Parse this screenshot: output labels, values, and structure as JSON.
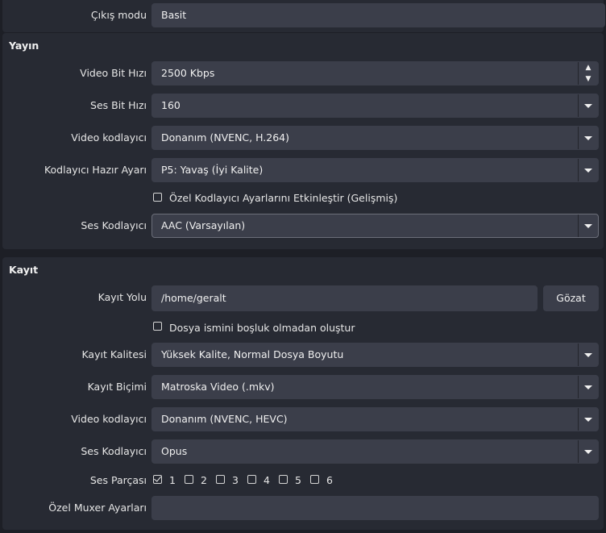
{
  "output_mode": {
    "label": "Çıkış modu",
    "value": "Basit"
  },
  "stream": {
    "title": "Yayın",
    "video_bitrate": {
      "label": "Video Bit Hızı",
      "value": "2500 Kbps"
    },
    "audio_bitrate": {
      "label": "Ses Bit Hızı",
      "value": "160"
    },
    "video_encoder": {
      "label": "Video kodlayıcı",
      "value": "Donanım (NVENC, H.264)"
    },
    "encoder_preset": {
      "label": "Kodlayıcı Hazır Ayarı",
      "value": "P5: Yavaş (İyi Kalite)"
    },
    "custom_encoder_checkbox": {
      "label": "Özel Kodlayıcı Ayarlarını Etkinleştir (Gelişmiş)",
      "checked": false
    },
    "audio_encoder": {
      "label": "Ses Kodlayıcı",
      "value": "AAC (Varsayılan)"
    }
  },
  "recording": {
    "title": "Kayıt",
    "path": {
      "label": "Kayıt Yolu",
      "value": "/home/geralt",
      "browse_label": "Gözat"
    },
    "no_space_checkbox": {
      "label": "Dosya ismini boşluk olmadan oluştur",
      "checked": false
    },
    "quality": {
      "label": "Kayıt Kalitesi",
      "value": "Yüksek Kalite, Normal Dosya Boyutu"
    },
    "format": {
      "label": "Kayıt Biçimi",
      "value": "Matroska Video (.mkv)"
    },
    "video_encoder": {
      "label": "Video kodlayıcı",
      "value": "Donanım (NVENC, HEVC)"
    },
    "audio_encoder": {
      "label": "Ses Kodlayıcı",
      "value": "Opus"
    },
    "audio_tracks": {
      "label": "Ses Parçası",
      "tracks": [
        {
          "label": "1",
          "checked": true
        },
        {
          "label": "2",
          "checked": false
        },
        {
          "label": "3",
          "checked": false
        },
        {
          "label": "4",
          "checked": false
        },
        {
          "label": "5",
          "checked": false
        },
        {
          "label": "6",
          "checked": false
        }
      ]
    },
    "muxer": {
      "label": "Özel Muxer Ayarları",
      "value": ""
    }
  },
  "icons": {
    "dropdown": "chevron-down-icon",
    "spin_up": "chevron-up-icon",
    "spin_down": "chevron-down-icon",
    "checkbox": "checkbox-icon"
  },
  "colors": {
    "background": "#1d1f26",
    "panel": "#272a33",
    "field": "#3b3e4a",
    "text": "#e6e6e6"
  }
}
